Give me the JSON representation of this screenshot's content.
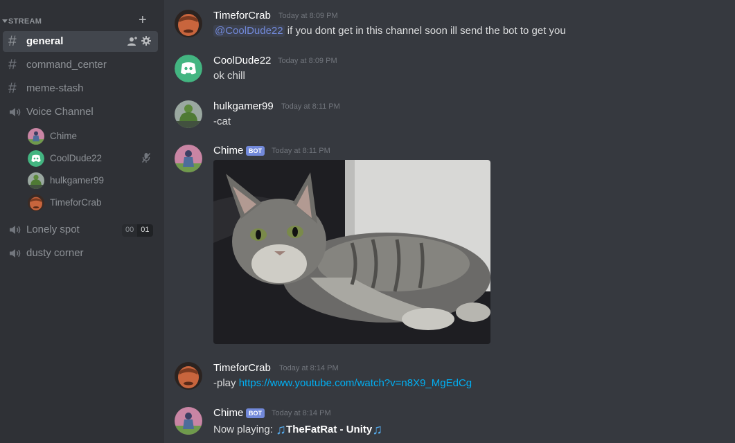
{
  "sidebar": {
    "category": {
      "label": "STREAM"
    },
    "text_channels": [
      {
        "name": "general"
      },
      {
        "name": "command_center"
      },
      {
        "name": "meme-stash"
      }
    ],
    "voice_channel": {
      "name": "Voice Channel"
    },
    "voice_users": [
      {
        "name": "Chime"
      },
      {
        "name": "CoolDude22"
      },
      {
        "name": "hulkgamer99"
      },
      {
        "name": "TimeforCrab"
      }
    ],
    "lonely_spot": {
      "name": "Lonely spot",
      "current": "00",
      "limit": "01"
    },
    "dusty_corner": {
      "name": "dusty corner"
    }
  },
  "messages": [
    {
      "author": "TimeforCrab",
      "timestamp": "Today at 8:09 PM",
      "mention": "@CoolDude22",
      "text": " if you dont get in this channel soon ill send the bot to get you"
    },
    {
      "author": "CoolDude22",
      "timestamp": "Today at 8:09 PM",
      "text": "ok chill"
    },
    {
      "author": "hulkgamer99",
      "timestamp": "Today at 8:11 PM",
      "text": "-cat"
    },
    {
      "author": "Chime",
      "bot_tag": "BOT",
      "timestamp": "Today at 8:11 PM"
    },
    {
      "author": "TimeforCrab",
      "timestamp": "Today at 8:14 PM",
      "prefix": "-play ",
      "link": "https://www.youtube.com/watch?v=n8X9_MgEdCg"
    },
    {
      "author": "Chime",
      "bot_tag": "BOT",
      "timestamp": "Today at 8:14 PM",
      "prefix": "Now playing: ",
      "song": "TheFatRat - Unity"
    }
  ],
  "colors": {
    "sidebar_bg": "#2f3136",
    "chat_bg": "#36393f",
    "selected_channel_bg": "#42464d",
    "blurple": "#7289da",
    "discord_green": "#43b581",
    "link_color": "#00b0f4"
  },
  "icons": {
    "category_chevron": "chevron-down-icon",
    "create_channel": "plus-icon",
    "text_channel": "hash-icon",
    "voice_channel": "speaker-icon",
    "invite": "add-user-icon",
    "settings": "gear-icon",
    "muted": "mic-muted-icon",
    "music_note": "music-note-icon"
  }
}
